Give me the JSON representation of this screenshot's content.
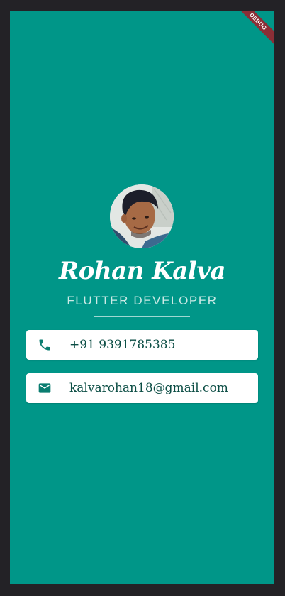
{
  "profile": {
    "name": "Rohan Kalva",
    "role": "FLUTTER DEVELOPER",
    "avatar": "profile-photo"
  },
  "contacts": {
    "phone": {
      "icon": "phone-icon",
      "value": "+91 9391785385"
    },
    "email": {
      "icon": "email-icon",
      "value": "kalvarohan18@gmail.com"
    }
  },
  "banner": {
    "label": "DEBUG"
  },
  "colors": {
    "background": "#009688",
    "frame": "#232226",
    "card": "#ffffff",
    "text_accent": "#0b4d44",
    "icon": "#0a7d70",
    "debug": "#8b2e36"
  }
}
